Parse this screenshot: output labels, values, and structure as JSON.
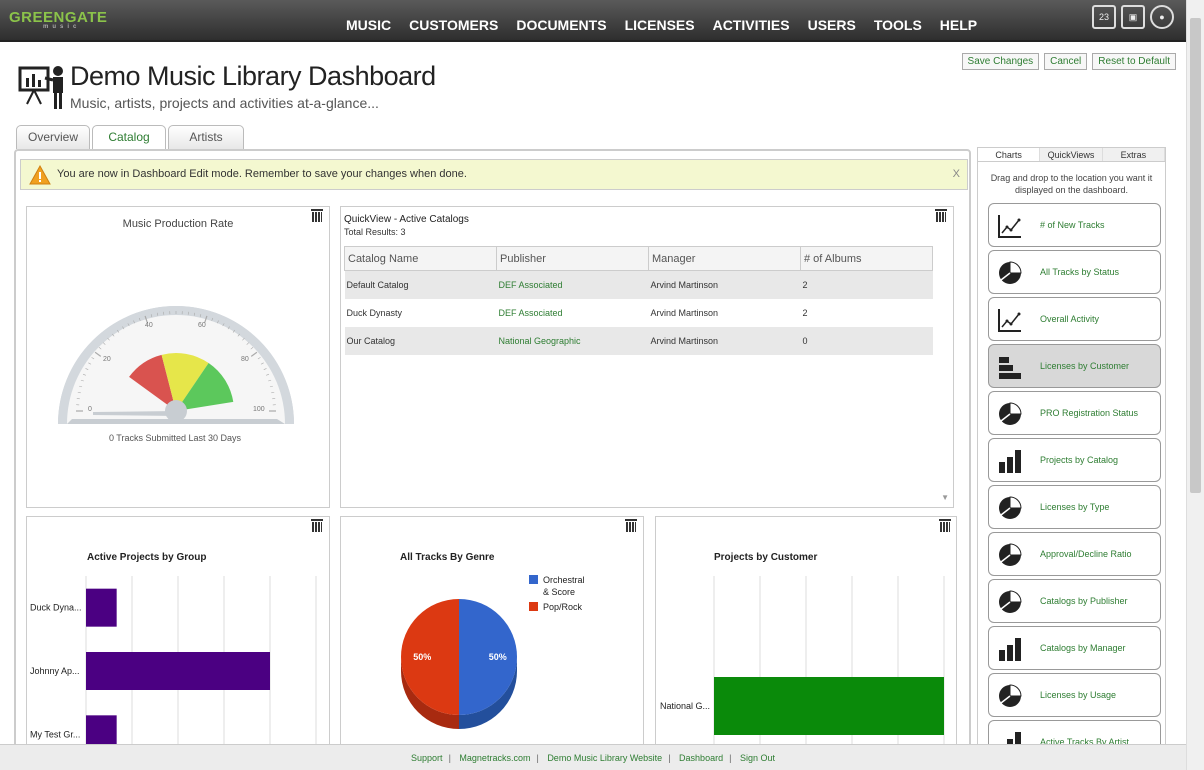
{
  "app": {
    "logo_text": "GREENGATE",
    "logo_sub": "music"
  },
  "nav": [
    "MUSIC",
    "CUSTOMERS",
    "DOCUMENTS",
    "LICENSES",
    "ACTIVITIES",
    "USERS",
    "TOOLS",
    "HELP"
  ],
  "top_icons": {
    "calendar_day": "23"
  },
  "page": {
    "title": "Demo Music Library Dashboard",
    "subtitle": "Music, artists, projects and activities at-a-glance..."
  },
  "actions": {
    "save": "Save Changes",
    "cancel": "Cancel",
    "reset": "Reset to Default"
  },
  "tabs": [
    "Overview",
    "Catalog",
    "Artists"
  ],
  "alert": {
    "message": "You are now in Dashboard Edit mode. Remember to save your changes when done.",
    "close": "X"
  },
  "gauge": {
    "title": "Music Production Rate",
    "ticks": [
      "0",
      "20",
      "40",
      "60",
      "80",
      "100"
    ],
    "value": 0,
    "caption": "0 Tracks Submitted Last 30 Days",
    "colors": {
      "red": "#d9534f",
      "yellow": "#e6e64a",
      "green": "#5cc85c"
    }
  },
  "quickview": {
    "title": "QuickView - Active Catalogs",
    "total": "Total Results: 3",
    "columns": [
      "Catalog Name",
      "Publisher",
      "Manager",
      "# of Albums"
    ],
    "rows": [
      [
        "Default Catalog",
        "DEF Associated",
        "Arvind Martinson",
        "2"
      ],
      [
        "Duck Dynasty",
        "DEF Associated",
        "Arvind Martinson",
        "2"
      ],
      [
        "Our Catalog",
        "National Geographic",
        "Arvind Martinson",
        "0"
      ]
    ]
  },
  "chart_data": [
    {
      "type": "bar",
      "orientation": "horizontal",
      "title": "Active Projects by Group",
      "categories": [
        "Duck Dyna...",
        "Johnny Ap...",
        "My Test Gr..."
      ],
      "values": [
        1,
        6,
        1
      ],
      "color": "#4b0082"
    },
    {
      "type": "pie",
      "title": "All Tracks By Genre",
      "labels": [
        "Orchestral & Score",
        "Pop/Rock"
      ],
      "values": [
        50,
        50
      ],
      "data_labels": [
        "50%",
        "50%"
      ],
      "colors": [
        "#3366cc",
        "#dc3912"
      ],
      "legend": "top-right"
    },
    {
      "type": "bar",
      "orientation": "horizontal",
      "title": "Projects by Customer",
      "categories": [
        "National G..."
      ],
      "values": [
        2
      ],
      "color": "#0a8a0a"
    }
  ],
  "sidebar": {
    "tabs": [
      "Charts",
      "QuickViews",
      "Extras"
    ],
    "hint": "Drag and drop to the location you want it displayed on the dashboard.",
    "items": [
      {
        "label": "# of New Tracks",
        "icon": "line-chart-icon"
      },
      {
        "label": "All Tracks by Status",
        "icon": "pie-chart-icon"
      },
      {
        "label": "Overall Activity",
        "icon": "line-chart-icon"
      },
      {
        "label": "Licenses by Customer",
        "icon": "bar-chart-horizontal-icon"
      },
      {
        "label": "PRO Registration Status",
        "icon": "pie-chart-icon"
      },
      {
        "label": "Projects by Catalog",
        "icon": "bar-chart-icon"
      },
      {
        "label": "Licenses by Type",
        "icon": "pie-chart-icon"
      },
      {
        "label": "Approval/Decline Ratio",
        "icon": "pie-chart-icon"
      },
      {
        "label": "Catalogs by Publisher",
        "icon": "pie-chart-icon"
      },
      {
        "label": "Catalogs by Manager",
        "icon": "bar-chart-icon"
      },
      {
        "label": "Licenses by Usage",
        "icon": "pie-chart-icon"
      },
      {
        "label": "Active Tracks By Artist",
        "icon": "bar-chart-icon"
      }
    ]
  },
  "footer": [
    "Support",
    "Magnetracks.com",
    "Demo Music Library Website",
    "Dashboard",
    "Sign Out"
  ]
}
